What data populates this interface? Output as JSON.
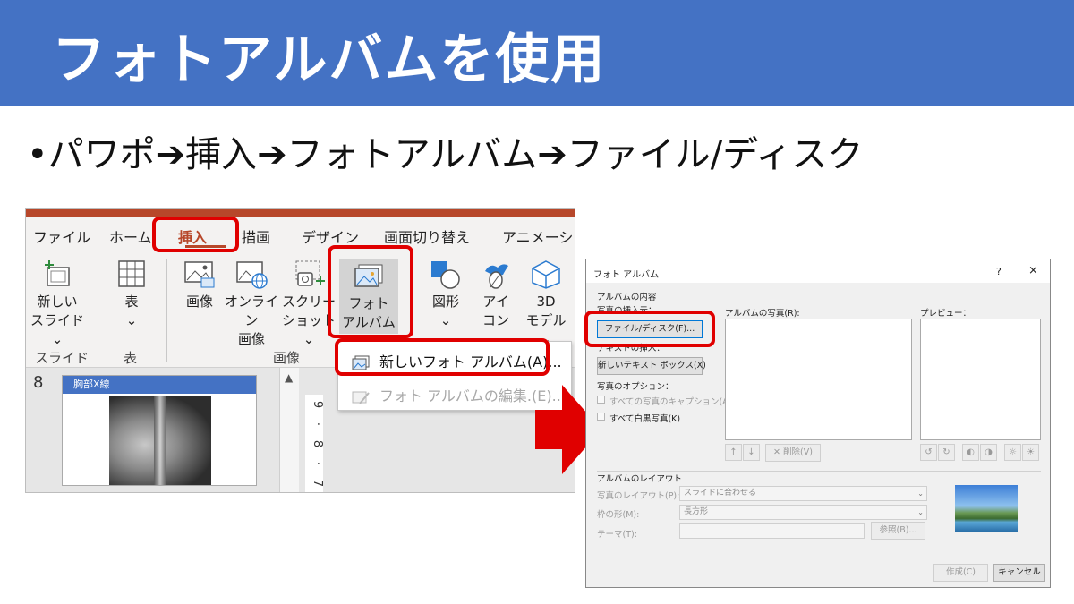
{
  "title": "フォトアルバムを使用",
  "bullet": "•パワポ➔挿入➔フォトアルバム➔ファイル/ディスク",
  "colors": {
    "title_bg": "#4472c4",
    "highlight": "#e00000",
    "accent": "#b7472a"
  },
  "ribbon": {
    "tabs": [
      "ファイル",
      "ホーム",
      "挿入",
      "描画",
      "デザイン",
      "画面切り替え",
      "アニメーション"
    ],
    "active_tab": "挿入",
    "buttons": {
      "new_slide": [
        "新しい",
        "スライド ⌄"
      ],
      "table": [
        "表",
        "⌄"
      ],
      "image": "画像",
      "online_image": [
        "オンライン",
        "画像"
      ],
      "screenshot": [
        "スクリー",
        "ショット ⌄"
      ],
      "photo_album": [
        "フォト",
        "アルバム ⌄"
      ],
      "shapes": [
        "図形",
        "⌄"
      ],
      "icons": [
        "アイ",
        "コン"
      ],
      "model3d": [
        "3D",
        "モデル ⌄"
      ]
    },
    "groups": {
      "slides": "スライド",
      "table": "表",
      "images": "画像"
    },
    "dropdown": {
      "new_album": "新しいフォト アルバム(A)...",
      "edit_album": "フォト アルバムの編集.(E)..."
    },
    "thumbnail": {
      "number": "8",
      "title": "胸部X線"
    },
    "ruler": [
      "9",
      "8",
      "7"
    ]
  },
  "dialog": {
    "title": "フォト アルバム",
    "help": "?",
    "close": "×",
    "content_section": "アルバムの内容",
    "insert_from": "写真の挿入元：",
    "file_disk_button": "ファイル/ディスク(F)...",
    "insert_text": "テキストの挿入：",
    "new_textbox_button": "新しいテキスト ボックス(X)",
    "photo_options": "写真のオプション：",
    "caption_all": "すべての写真のキャプション(A)",
    "all_bw": "すべて白黒写真(K)",
    "album_photos": "アルバムの写真(R):",
    "preview": "プレビュー：",
    "delete_button": "削除(V)",
    "layout_section": "アルバムのレイアウト",
    "photo_layout_label": "写真のレイアウト(P):",
    "photo_layout_value": "スライドに合わせる",
    "frame_shape_label": "枠の形(M):",
    "frame_shape_value": "長方形",
    "theme_label": "テーマ(T):",
    "browse_button": "参照(B)...",
    "create_button": "作成(C)",
    "cancel_button": "キャンセル"
  }
}
